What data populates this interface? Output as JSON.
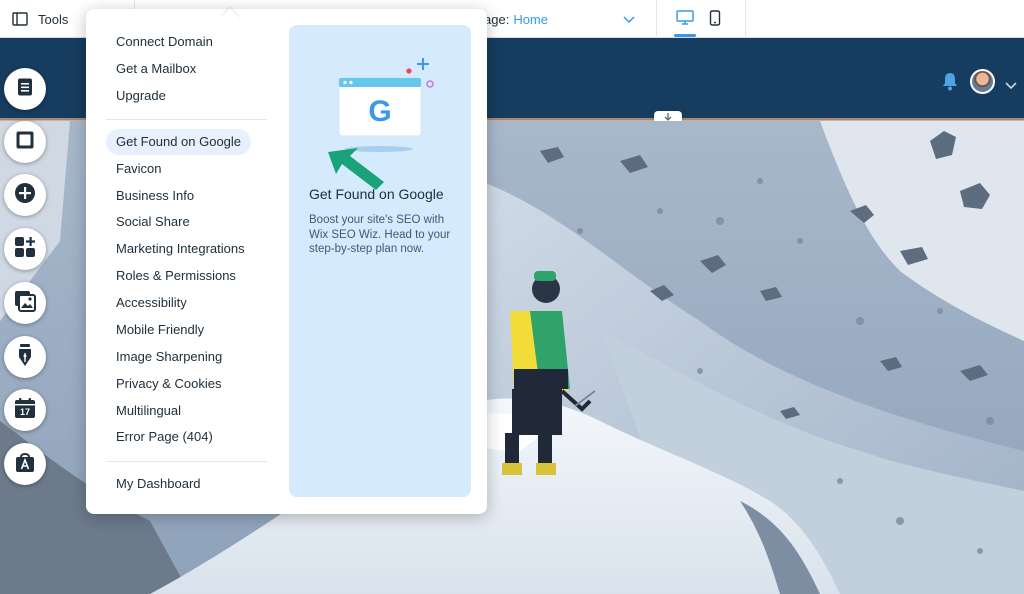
{
  "topbar": {
    "tools_label": "Tools",
    "page_prefix": "age:",
    "page_value": "Home"
  },
  "menu": {
    "group1": [
      "Connect Domain",
      "Get a Mailbox",
      "Upgrade"
    ],
    "group2": [
      "Get Found on Google",
      "Favicon",
      "Business Info",
      "Social Share",
      "Marketing Integrations",
      "Roles & Permissions",
      "Accessibility",
      "Mobile Friendly",
      "Image Sharpening",
      "Privacy & Cookies",
      "Multilingual",
      "Error Page (404)"
    ],
    "group3": [
      "My Dashboard"
    ],
    "active_item": "Get Found on Google"
  },
  "promo": {
    "title": "Get Found on Google",
    "text": "Boost your site's SEO with Wix SEO Wiz. Head to your step-by-step plan now.",
    "logo_letter": "G"
  },
  "left_toolbar": [
    "pages-icon",
    "background-icon",
    "add-icon",
    "add-apps-icon",
    "media-icon",
    "blog-pen-icon",
    "bookings-calendar-icon",
    "app-market-icon"
  ],
  "calendar_badge": "17",
  "colors": {
    "accent": "#3899ec",
    "header_navy": "#163c5f",
    "arrow_green": "#1aa37a",
    "promo_bg": "#d5eafc"
  }
}
